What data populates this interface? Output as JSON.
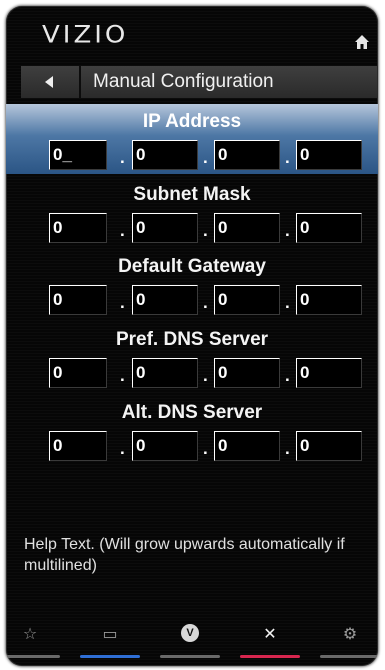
{
  "brand": "VIZIO",
  "header": {
    "title": "Manual Configuration"
  },
  "sections": [
    {
      "label": "IP Address",
      "octets": [
        "0_",
        "0",
        "0",
        "0"
      ],
      "selected": true
    },
    {
      "label": "Subnet Mask",
      "octets": [
        "0",
        "0",
        "0",
        "0"
      ],
      "selected": false
    },
    {
      "label": "Default Gateway",
      "octets": [
        "0",
        "0",
        "0",
        "0"
      ],
      "selected": false
    },
    {
      "label": "Pref. DNS Server",
      "octets": [
        "0",
        "0",
        "0",
        "0"
      ],
      "selected": false
    },
    {
      "label": "Alt. DNS Server",
      "octets": [
        "0",
        "0",
        "0",
        "0"
      ],
      "selected": false
    }
  ],
  "separator": ".",
  "help_text": "Help Text. (Will grow upwards automatically if multilined)",
  "navbar": {
    "buttons": [
      {
        "name": "star",
        "glyph": "☆",
        "underline_color": "#6a6a6a"
      },
      {
        "name": "screen",
        "glyph": "▭",
        "underline_color": "#2f6fd6"
      },
      {
        "name": "vizio",
        "glyph": "V",
        "underline_color": "#6a6a6a"
      },
      {
        "name": "close",
        "glyph": "✕",
        "underline_color": "#d8264f"
      },
      {
        "name": "gear",
        "glyph": "⚙",
        "underline_color": "#6a6a6a"
      }
    ]
  },
  "colors": {
    "selected_gradient_top": "#b6c6db",
    "selected_gradient_bottom": "#2b5585"
  }
}
